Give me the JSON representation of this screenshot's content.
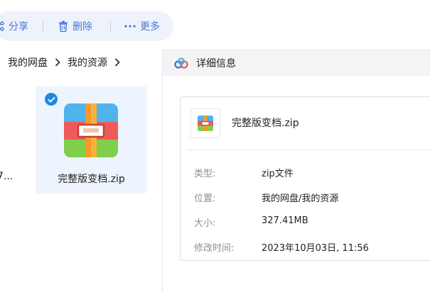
{
  "toolbar": {
    "share_label": "分享",
    "delete_label": "删除",
    "more_label": "更多"
  },
  "breadcrumb": {
    "items": [
      "我的网盘",
      "我的资源"
    ]
  },
  "file_list": {
    "partial_name": "7...",
    "selected_file": {
      "name": "完整版变档.zip",
      "selected": true
    }
  },
  "detail_panel": {
    "title": "详细信息",
    "file_name": "完整版变档.zip",
    "rows": [
      {
        "label": "类型:",
        "value": "zip文件"
      },
      {
        "label": "位置:",
        "value": "我的网盘/我的资源"
      },
      {
        "label": "大小:",
        "value": "327.41MB"
      },
      {
        "label": "修改时间:",
        "value": "2023年10月03日, 11:56"
      }
    ]
  },
  "colors": {
    "accent": "#4a74d9",
    "toolbar_bg": "#eef3fb",
    "selected_bg": "#eef4fd",
    "check_badge": "#1e88e5",
    "label_gray": "#8a8f99"
  },
  "icons": [
    "share-icon",
    "trash-icon",
    "more-dots-icon",
    "chevron-right-icon",
    "check-icon",
    "zip-file-icon",
    "cloud-logo-icon"
  ]
}
